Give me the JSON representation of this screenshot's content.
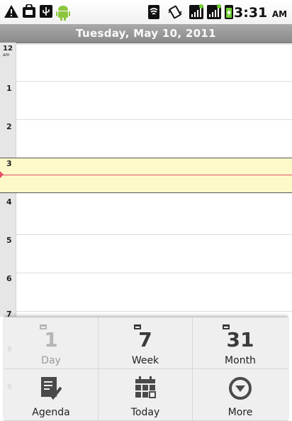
{
  "status_bar": {
    "time": "3:31",
    "ampm": "AM",
    "icons": [
      "warning-icon",
      "android-market-icon",
      "usb-icon",
      "android-icon",
      "wifi-icon",
      "vibrate-icon",
      "signal-icon",
      "signal-icon",
      "battery-charging-icon"
    ]
  },
  "header": {
    "date": "Tuesday, May 10, 2011"
  },
  "day_view": {
    "hours": [
      {
        "label": "12",
        "ampm": "am"
      },
      {
        "label": "1"
      },
      {
        "label": "2"
      },
      {
        "label": "3"
      },
      {
        "label": "4"
      },
      {
        "label": "5"
      },
      {
        "label": "6"
      },
      {
        "label": "7"
      },
      {
        "label": "8"
      },
      {
        "label": "9"
      }
    ],
    "highlight_color": "#fdf9c9",
    "now_line_color": "#e84f6a"
  },
  "menu": {
    "items": [
      {
        "label": "Day",
        "icon": "calendar-day-icon",
        "number": "1",
        "enabled": false
      },
      {
        "label": "Week",
        "icon": "calendar-week-icon",
        "number": "7",
        "enabled": true
      },
      {
        "label": "Month",
        "icon": "calendar-month-icon",
        "number": "31",
        "enabled": true
      },
      {
        "label": "Agenda",
        "icon": "agenda-icon",
        "enabled": true
      },
      {
        "label": "Today",
        "icon": "today-icon",
        "enabled": true
      },
      {
        "label": "More",
        "icon": "more-icon",
        "enabled": true
      }
    ]
  }
}
